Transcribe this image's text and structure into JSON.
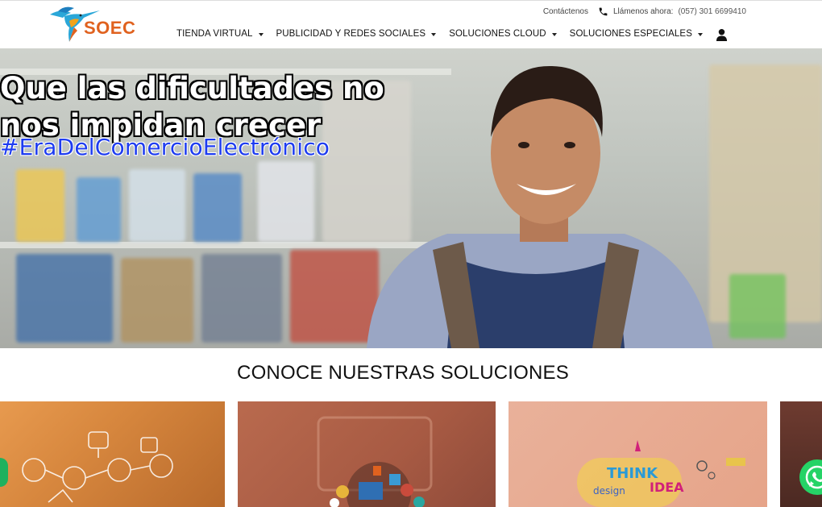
{
  "brand": {
    "name": "SOEC",
    "color": "#e0621f"
  },
  "topbar": {
    "contact_label": "Contáctenos",
    "call_label": "Llámenos ahora:",
    "phone": "(057) 301 6699410"
  },
  "nav": {
    "items": [
      {
        "label": "TIENDA VIRTUAL"
      },
      {
        "label": "PUBLICIDAD Y REDES SOCIALES"
      },
      {
        "label": "SOLUCIONES CLOUD"
      },
      {
        "label": "SOLUCIONES ESPECIALES"
      }
    ],
    "user_icon": "user-icon"
  },
  "hero": {
    "title_line1": "Que las dificultades no",
    "title_line2": "nos impidan crecer",
    "hashtag": "#EraDelComercioElectrónico",
    "hashtag_color": "#1e3cf0"
  },
  "solutions": {
    "title": "CONOCE NUESTRAS SOLUCIONES"
  },
  "icons": {
    "phone": "phone-icon",
    "whatsapp": "whatsapp-icon",
    "caret": "chevron-down-icon"
  }
}
